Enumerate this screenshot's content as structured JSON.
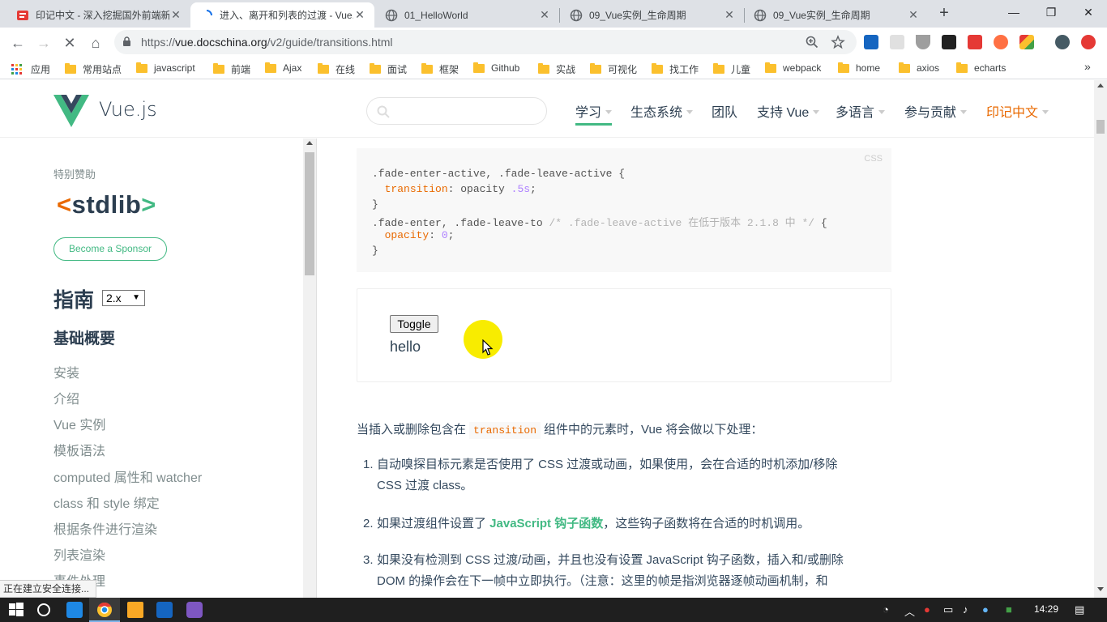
{
  "browser": {
    "tabs": [
      {
        "title": "印记中文 - 深入挖掘国外前端新",
        "active": false
      },
      {
        "title": "进入、离开和列表的过渡 - Vue.j",
        "active": true
      },
      {
        "title": "01_HelloWorld",
        "active": false
      },
      {
        "title": "09_Vue实例_生命周期",
        "active": false
      },
      {
        "title": "09_Vue实例_生命周期",
        "active": false
      }
    ],
    "new_tab": "+",
    "window": {
      "minimize": "—",
      "restore": "❐",
      "close": "✕"
    },
    "url": {
      "scheme": "https://",
      "host": "vue.docschina.org",
      "path": "/v2/guide/transitions.html"
    },
    "bookmarks": [
      "应用",
      "常用站点",
      "javascript",
      "前端",
      "Ajax",
      "在线",
      "面试",
      "框架",
      "Github",
      "实战",
      "可视化",
      "找工作",
      "儿童",
      "webpack",
      "home",
      "axios",
      "echarts"
    ],
    "bookmarks_more": "»",
    "status_text": "正在建立安全连接..."
  },
  "site": {
    "logo_text": "Vue.js",
    "nav": [
      {
        "label": "学习",
        "dropdown": true,
        "current": true
      },
      {
        "label": "生态系统",
        "dropdown": true
      },
      {
        "label": "团队",
        "dropdown": false
      },
      {
        "label": "支持 Vue",
        "dropdown": true
      },
      {
        "label": "多语言",
        "dropdown": true
      },
      {
        "label": "参与贡献",
        "dropdown": true
      },
      {
        "label": "印记中文",
        "dropdown": true,
        "accent": "#e96900"
      }
    ]
  },
  "sidebar": {
    "sponsor_label": "特别赞助",
    "sponsor_logo": "stdlib",
    "sponsor_button": "Become a Sponsor",
    "guide_title": "指南",
    "version": "2.x",
    "section_title": "基础概要",
    "links": [
      "安装",
      "介绍",
      "Vue 实例",
      "模板语法",
      "computed 属性和 watcher",
      "class 和 style 绑定",
      "根据条件进行渲染",
      "列表渲染",
      "事件处理"
    ]
  },
  "content": {
    "code_lang": "CSS",
    "code": {
      "l1_sel": ".fade-enter-active, .fade-leave-active {",
      "l2_prop": "transition",
      "l2_val": ": opacity ",
      "l2_num": ".5s",
      "l2_end": ";",
      "l3": "}",
      "l4_sel": ".fade-enter, .fade-leave-to ",
      "l4_cm": "/* .fade-leave-active 在低于版本 2.1.8 中 */",
      "l4_end": " {",
      "l5_prop": "opacity",
      "l5_val": ": ",
      "l5_num": "0",
      "l5_end": ";",
      "l6": "}"
    },
    "demo": {
      "button": "Toggle",
      "text": "hello"
    },
    "intro_before": "当插入或删除包含在",
    "intro_code": "transition",
    "intro_after": "组件中的元素时，Vue 将会做以下处理：",
    "list": [
      {
        "num": "1.",
        "line1": "自动嗅探目标元素是否使用了 CSS 过渡或动画，如果使用，会在合适的时机添加/移除",
        "line2": "CSS 过渡 class。"
      },
      {
        "num": "2.",
        "before": "如果过渡组件设置了 ",
        "link": "JavaScript 钩子函数",
        "after": "，这些钩子函数将在合适的时机调用。"
      },
      {
        "num": "3.",
        "line1": "如果没有检测到 CSS 过渡/动画，并且也没有设置 JavaScript 钩子函数，插入和/或删除",
        "line2": "DOM 的操作会在下一帧中立即执行。（注意：这里的帧是指浏览器逐帧动画机制，和"
      }
    ]
  },
  "taskbar": {
    "time": "14:29"
  },
  "colors": {
    "vue_green": "#42b983",
    "text_dark": "#2c3e50",
    "accent_orange": "#e96900"
  }
}
